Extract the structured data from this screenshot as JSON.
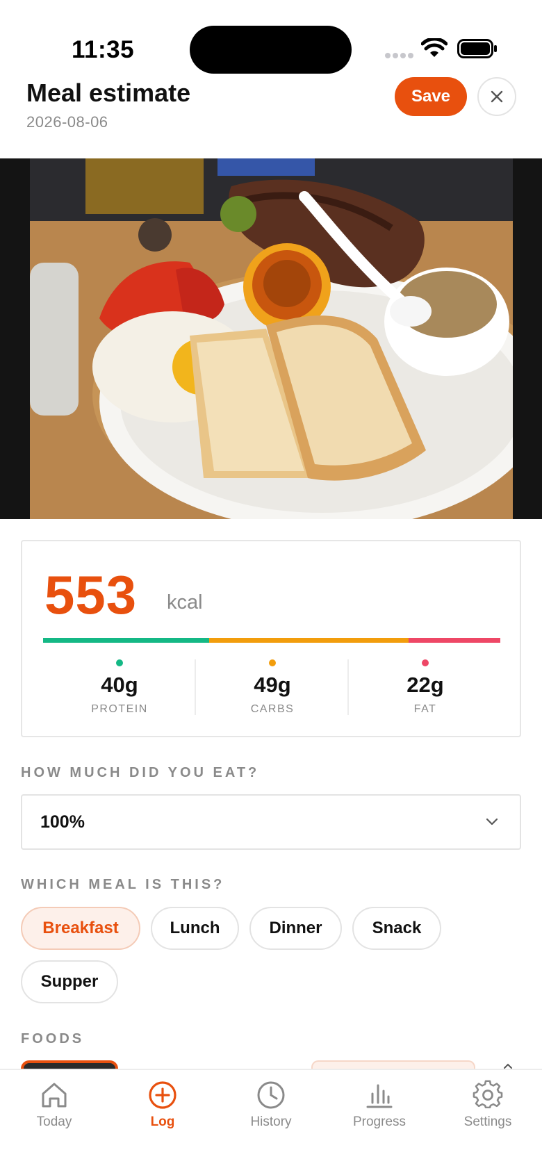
{
  "status_bar": {
    "time": "11:35"
  },
  "header": {
    "title": "Meal estimate",
    "date": "2026-08-06",
    "save_label": "Save"
  },
  "summary": {
    "calories": "553",
    "unit": "kcal",
    "macros": [
      {
        "value": "40g",
        "label": "PROTEIN",
        "color": "#14b885"
      },
      {
        "value": "49g",
        "label": "CARBS",
        "color": "#f29d0c"
      },
      {
        "value": "22g",
        "label": "FAT",
        "color": "#ee4766"
      }
    ],
    "bar_split": [
      0.363,
      0.437,
      0.2
    ]
  },
  "portion": {
    "label": "HOW MUCH DID YOU EAT?",
    "selected": "100%"
  },
  "meal": {
    "label": "WHICH MEAL IS THIS?",
    "options": [
      "Breakfast",
      "Lunch",
      "Dinner",
      "Snack",
      "Supper"
    ],
    "selected": "Breakfast"
  },
  "foods": {
    "label": "FOODS"
  },
  "tabs": [
    {
      "label": "Today",
      "icon": "home-icon"
    },
    {
      "label": "Log",
      "icon": "plus-circle-icon",
      "active": true
    },
    {
      "label": "History",
      "icon": "clock-icon"
    },
    {
      "label": "Progress",
      "icon": "bar-chart-icon"
    },
    {
      "label": "Settings",
      "icon": "gear-icon"
    }
  ],
  "colors": {
    "accent": "#e8500e",
    "accent_soft": "#fdf0ea",
    "muted": "#8a8a8a"
  }
}
